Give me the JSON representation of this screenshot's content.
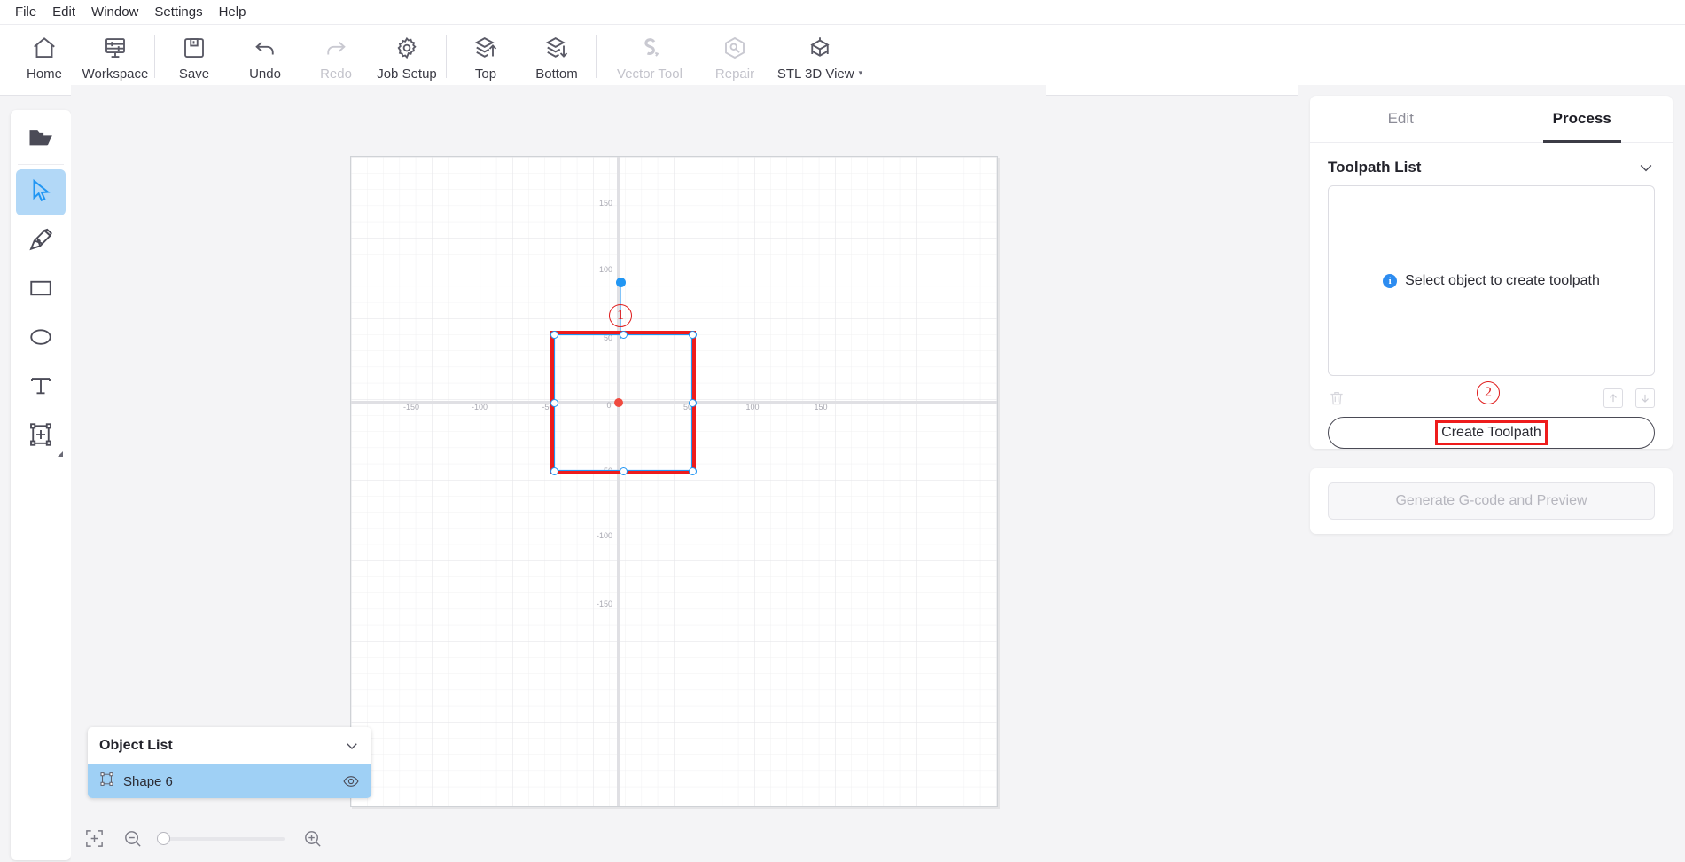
{
  "menubar": {
    "items": [
      {
        "label": "File"
      },
      {
        "label": "Edit"
      },
      {
        "label": "Window"
      },
      {
        "label": "Settings"
      },
      {
        "label": "Help"
      }
    ]
  },
  "toolbar": {
    "buttons": [
      {
        "label": "Home",
        "icon": "home-icon",
        "disabled": false
      },
      {
        "label": "Workspace",
        "icon": "workspace-icon",
        "disabled": false
      },
      {
        "label": "Save",
        "icon": "save-icon",
        "disabled": false
      },
      {
        "label": "Undo",
        "icon": "undo-icon",
        "disabled": false
      },
      {
        "label": "Redo",
        "icon": "redo-icon",
        "disabled": true
      },
      {
        "label": "Job Setup",
        "icon": "gear-icon",
        "disabled": false
      },
      {
        "label": "Top",
        "icon": "layers-up-icon",
        "disabled": false
      },
      {
        "label": "Bottom",
        "icon": "layers-down-icon",
        "disabled": false
      },
      {
        "label": "Vector Tool",
        "icon": "vector-tool-icon",
        "disabled": true
      },
      {
        "label": "Repair",
        "icon": "repair-icon",
        "disabled": true
      },
      {
        "label": "STL 3D View",
        "icon": "cube-3d-icon",
        "disabled": false,
        "caret": "▾"
      }
    ]
  },
  "lefttools": {
    "items": [
      {
        "name": "open-file-tool",
        "icon": "folder-icon",
        "selected": false
      },
      {
        "name": "select-tool",
        "icon": "cursor-arrow-icon",
        "selected": true
      },
      {
        "name": "pen-tool",
        "icon": "pen-nib-icon",
        "selected": false
      },
      {
        "name": "rectangle-tool",
        "icon": "rectangle-icon",
        "selected": false
      },
      {
        "name": "ellipse-tool",
        "icon": "ellipse-icon",
        "selected": false
      },
      {
        "name": "text-tool",
        "icon": "text-icon",
        "selected": false
      },
      {
        "name": "insert-object-tool",
        "icon": "insert-frame-icon",
        "selected": false
      }
    ]
  },
  "canvas": {
    "x_axis_labels": [
      "-150",
      "-100",
      "100",
      "150"
    ],
    "y_axis_labels": [
      "150",
      "100",
      "-50",
      "-100",
      "-150"
    ],
    "origin_label": "0",
    "annotation_1": "①",
    "annotation_1_text": "1",
    "selection": {
      "handles": 8,
      "rotation_handle": true,
      "accent_color": "#2196f3",
      "highlight_color": "#ee1c1c",
      "origin_color": "#f04a3f"
    }
  },
  "objectlist": {
    "title": "Object List",
    "collapse_icon": "chevron-down-icon",
    "rows": [
      {
        "name": "Shape 6",
        "icon": "shape-node-icon",
        "visibility_icon": "eye-icon",
        "selected": true
      }
    ]
  },
  "zoombar": {
    "fit_icon": "fit-to-screen-icon",
    "zoom_out_icon": "zoom-out-icon",
    "zoom_in_icon": "zoom-in-icon",
    "slider_value": 0
  },
  "rightpanel": {
    "tabs": [
      {
        "label": "Edit",
        "active": false
      },
      {
        "label": "Process",
        "active": true
      }
    ],
    "toolpath": {
      "title": "Toolpath List",
      "collapse_icon": "chevron-down-icon",
      "empty_message": "Select object to create toolpath",
      "info_icon": "info-icon",
      "delete_icon": "trash-icon",
      "move_up_icon": "arrow-up-icon",
      "move_down_icon": "arrow-down-icon",
      "create_button": "Create Toolpath",
      "annotation_2_text": "2"
    },
    "generate": {
      "button_label": "Generate G-code and Preview",
      "disabled": true
    }
  }
}
